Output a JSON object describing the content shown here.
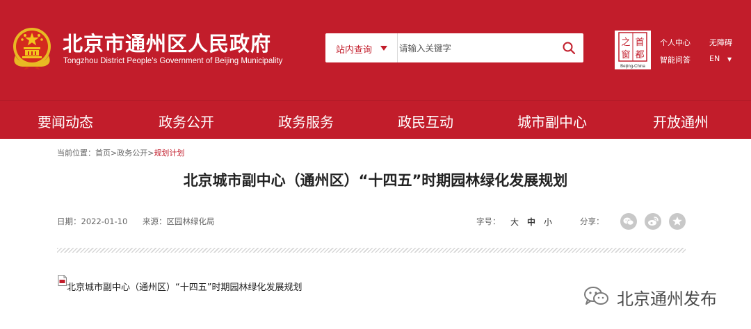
{
  "header": {
    "title": "北京市通州区人民政府",
    "subtitle": "Tongzhou District People's Government of Beijing Municipality",
    "background": "#c21d2b",
    "emblem_icon": "national-emblem-icon",
    "seal_logo": {
      "chars": [
        "之",
        "首",
        "窗",
        "都"
      ],
      "caption": "Beijing-China"
    },
    "links": {
      "personal_center": "个人中心",
      "accessibility": "无障碍",
      "smart_qa": "智能问答",
      "language": "EN"
    }
  },
  "search": {
    "scope_label": "站内查询",
    "placeholder": "请输入关键字",
    "icon": "search-icon"
  },
  "nav": {
    "items": [
      {
        "label": "要闻动态"
      },
      {
        "label": "政务公开"
      },
      {
        "label": "政务服务"
      },
      {
        "label": "政民互动"
      },
      {
        "label": "城市副中心"
      },
      {
        "label": "开放通州"
      }
    ]
  },
  "breadcrumb": {
    "prefix": "当前位置：",
    "items": [
      "首页",
      "政务公开",
      "规划计划"
    ],
    "separator": ">"
  },
  "article": {
    "title": "北京城市副中心（通州区）“十四五”时期园林绿化发展规划",
    "date": "日期：2022-01-10",
    "source": "来源：区园林绿化局",
    "font_size_label": "字号：",
    "font_sizes": [
      "大",
      "中",
      "小"
    ],
    "share_label": "分享：",
    "share_icons": [
      "wechat-icon",
      "weibo-icon",
      "favorite-icon"
    ],
    "attachment": "北京城市副中心（通州区）“十四五”时期园林绿化发展规划"
  },
  "watermark": {
    "text": "北京通州发布",
    "icon": "wechat-icon"
  },
  "colors": {
    "brand_red": "#c21d2b",
    "text": "#222222",
    "muted": "#666666",
    "share_grey": "#c8c8c8"
  }
}
